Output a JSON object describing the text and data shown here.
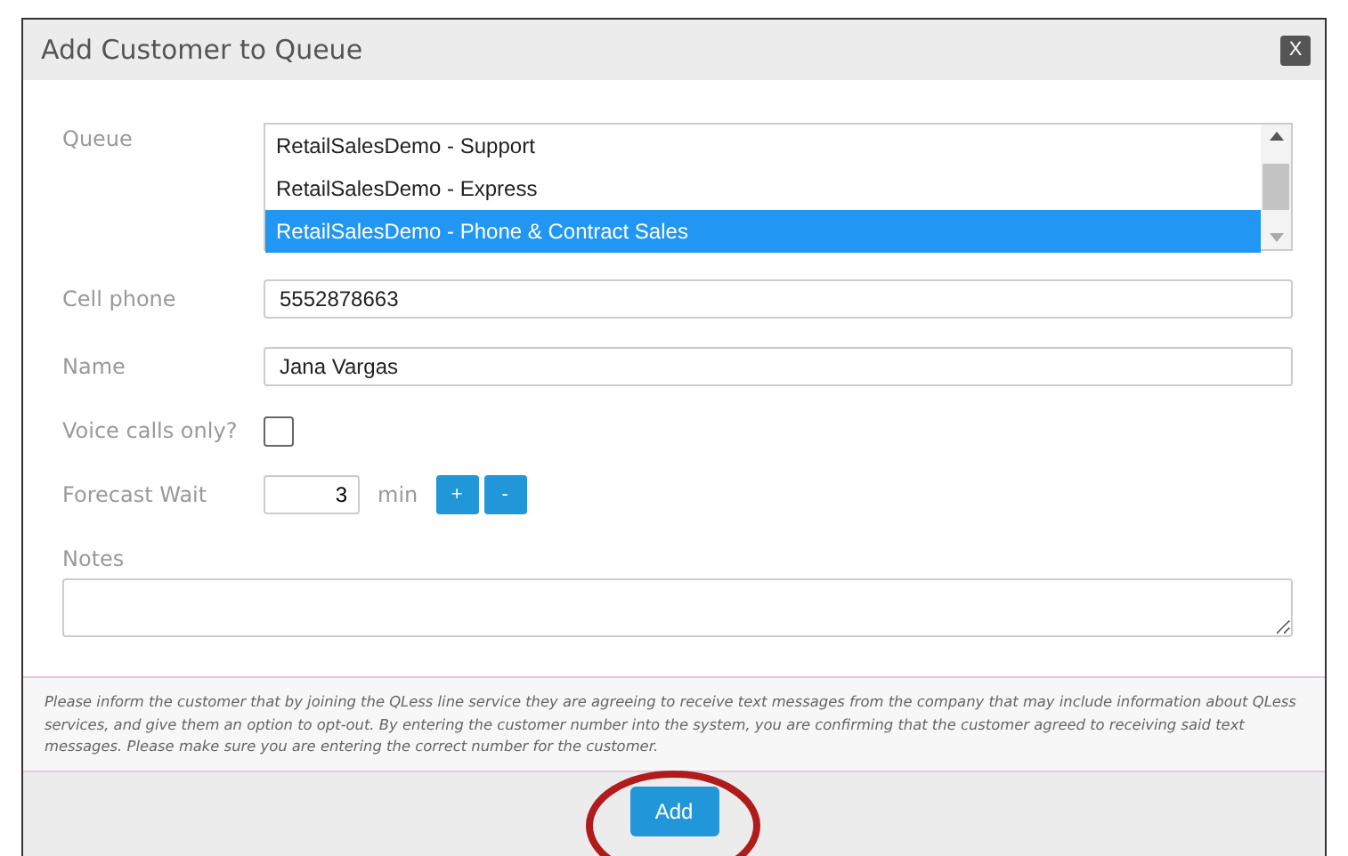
{
  "dialog": {
    "title": "Add Customer to Queue",
    "close": "X"
  },
  "queue": {
    "label": "Queue",
    "options": [
      {
        "text": "RetailSalesDemo - Support",
        "selected": false
      },
      {
        "text": "RetailSalesDemo - Express",
        "selected": false
      },
      {
        "text": "RetailSalesDemo - Phone & Contract Sales",
        "selected": true
      }
    ]
  },
  "cell_phone": {
    "label": "Cell phone",
    "value": "5552878663"
  },
  "name": {
    "label": "Name",
    "value": "Jana Vargas"
  },
  "voice_calls_only": {
    "label": "Voice calls only?",
    "checked": false
  },
  "forecast_wait": {
    "label": "Forecast Wait",
    "value": "3",
    "unit": "min",
    "buttons": [
      "+",
      "-"
    ]
  },
  "notes": {
    "label": "Notes"
  },
  "notice": "Please inform the customer that by joining the QLess line service they are agreeing to receive text messages from the company that may include information about QLess services, and give them an option to opt-out. By entering the customer number into the system, you are confirming that the customer agreed to receiving said text messages. Please make sure you are entering the correct number for the customer.",
  "add_button": "Add",
  "annotation": {
    "kind": "circle",
    "color": "#b01c1c"
  }
}
